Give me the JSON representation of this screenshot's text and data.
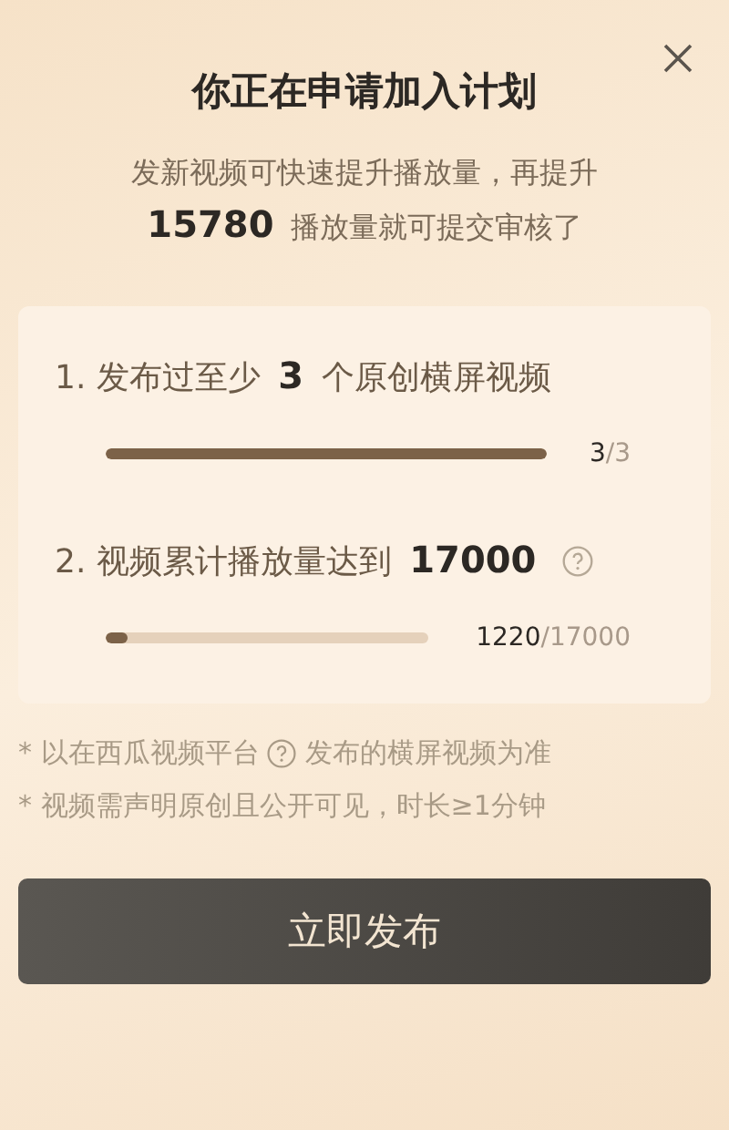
{
  "dialog": {
    "title": "你正在申请加入计划",
    "subtitle_lines": [
      "发新视频可快速提升播放量，再提升",
      "**15780** 播放量就可提交审核了"
    ]
  },
  "requirements": [
    {
      "text": "1. 发布过至少 **3** 个原创横屏视频",
      "help": false,
      "level": 1,
      "count": "3",
      "target": "/3"
    },
    {
      "text": "2. 视频累计播放量达到 **17000**",
      "help": true,
      "level": 0.07,
      "count": "1220",
      "target": "/17000"
    }
  ],
  "notes": [
    {
      "before": "* 以在西瓜视频平台",
      "help": true,
      "after": "发布的横屏视频为准"
    },
    {
      "before": "* 视频需声明原创且公开可见，时长≥1分钟",
      "help": false
    }
  ],
  "button": "立即发布"
}
